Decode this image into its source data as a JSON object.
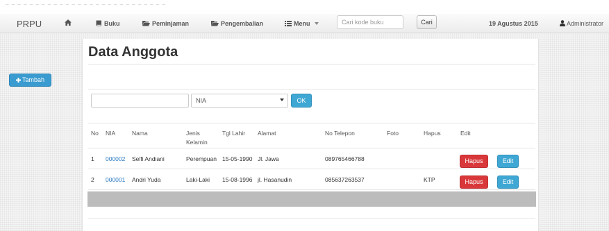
{
  "navbar": {
    "brand": "PRPU",
    "home_icon": "home-icon",
    "items": [
      {
        "label": "Buku",
        "icon": "book-icon"
      },
      {
        "label": "Peminjaman",
        "icon": "folder-open-icon"
      },
      {
        "label": "Pengembalian",
        "icon": "folder-open-icon"
      },
      {
        "label": "Menu",
        "icon": "list-icon"
      }
    ],
    "search": {
      "placeholder": "Cari kode buku",
      "value": "",
      "button_label": "Cari"
    },
    "date": "19 Agustus 2015",
    "user": "Administrator"
  },
  "page": {
    "title": "Data Anggota",
    "add_button": "Tambah",
    "filter": {
      "input_value": "",
      "select_value": "NIA",
      "ok_label": "OK"
    }
  },
  "table": {
    "headers": [
      "No",
      "NIA",
      "Nama",
      "Jenis Kelamin",
      "Tgl Lahir",
      "Alamat",
      "No Telepon",
      "Foto",
      "Hapus",
      "Edit"
    ],
    "rows": [
      {
        "no": "1",
        "nia": "000002",
        "nama": "Selfi Andiani",
        "jk": "Perempuan",
        "tgl": "15-05-1990",
        "alamat": "Jl. Jawa",
        "telp": "089765466788",
        "foto": "",
        "hapus_col": "",
        "hapus_btn": "Hapus",
        "edit_btn": "Edit"
      },
      {
        "no": "2",
        "nia": "000001",
        "nama": "Andri Yuda",
        "jk": "Laki-Laki",
        "tgl": "15-08-1996",
        "alamat": "jl. Hasanudin",
        "telp": "085637263537",
        "foto": "",
        "hapus_col": "KTP",
        "hapus_btn": "Hapus",
        "edit_btn": "Edit"
      }
    ]
  },
  "colors": {
    "primary": "#3a9bd0",
    "danger": "#d9383a",
    "info": "#3fa7d3",
    "link": "#2a7ac0"
  }
}
